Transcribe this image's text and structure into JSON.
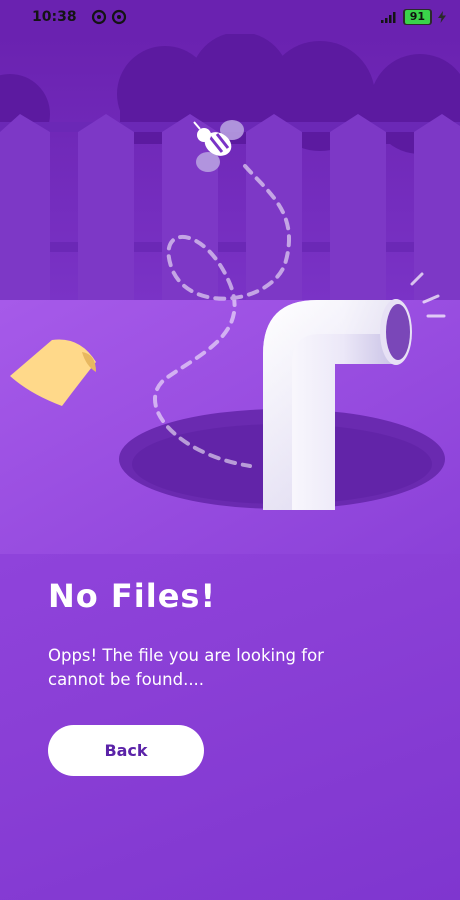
{
  "status_bar": {
    "time": "10:38",
    "battery_level": "91",
    "icons": [
      "sync-icon",
      "sync-icon",
      "signal-icon",
      "battery-icon",
      "charging-bolt-icon"
    ]
  },
  "illustration": {
    "icons": [
      "bee-icon",
      "sticky-note-icon",
      "pipe-icon",
      "hole-icon",
      "fence-icon",
      "bush-icon"
    ]
  },
  "content": {
    "title": "No Files!",
    "message": "Opps! The file you are looking for cannot be found....",
    "back_button_label": "Back"
  },
  "colors": {
    "background": "#8a3fd6",
    "status_bar": "#6a22b0",
    "button_text": "#5b23a8",
    "text": "#ffffff"
  }
}
